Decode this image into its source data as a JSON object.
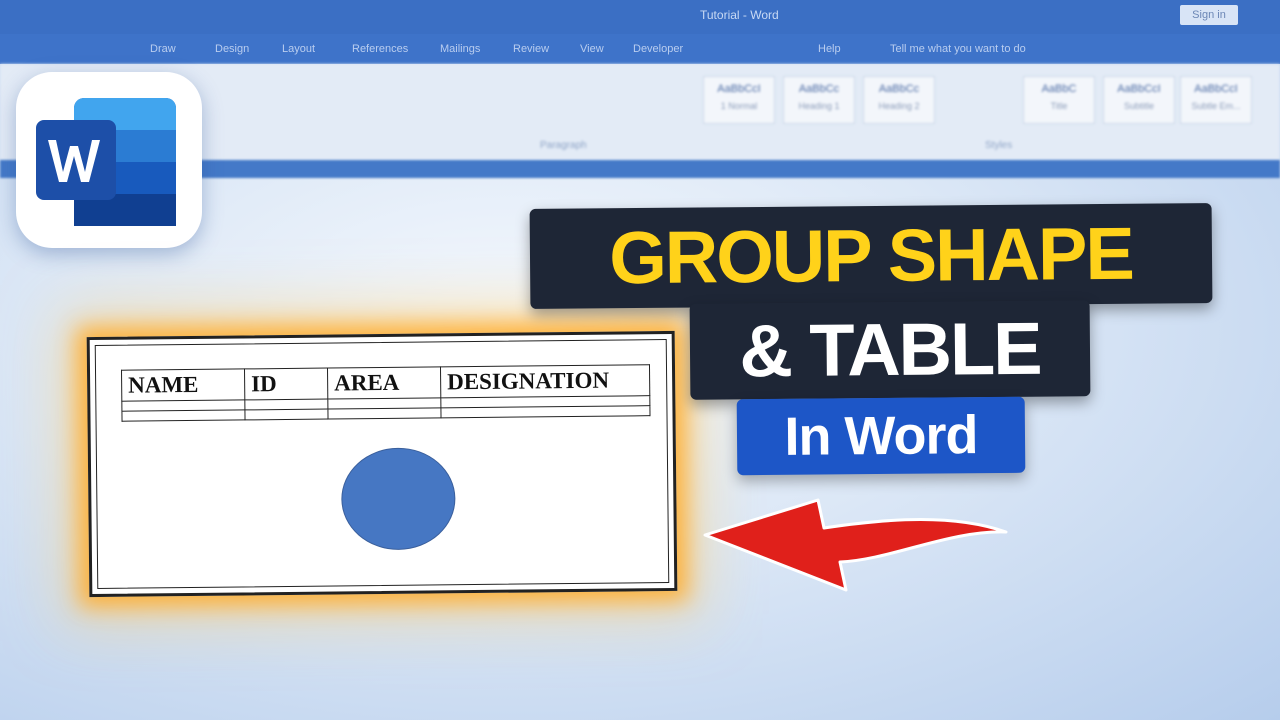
{
  "window": {
    "title": "Tutorial - Word",
    "sign_in": "Sign in"
  },
  "menu": [
    "Draw",
    "Design",
    "Layout",
    "References",
    "Mailings",
    "Review",
    "View",
    "Developer",
    "Help",
    "Tell me what you want to do"
  ],
  "ribbon": {
    "groups": [
      "Paragraph",
      "Styles"
    ],
    "styles": [
      {
        "sample": "AaBbCcI",
        "name": "1 Normal"
      },
      {
        "sample": "AaBbCc",
        "name": "Heading 1"
      },
      {
        "sample": "AaBbCc",
        "name": "Heading 2"
      },
      {
        "sample": "AaBbC",
        "name": "Title"
      },
      {
        "sample": "AaBbCcI",
        "name": "Subtitle"
      },
      {
        "sample": "AaBbCcI",
        "name": "Subtle Em..."
      }
    ]
  },
  "thumbnail": {
    "logo": "Microsoft Word",
    "headline_1": "GROUP SHAPE",
    "headline_2": "& TABLE",
    "badge": "In Word",
    "table_headers": [
      "NAME",
      "ID",
      "AREA",
      "DESIGNATION"
    ],
    "colors": {
      "headline_yellow": "#ffd21a",
      "headline_bg": "#1e2636",
      "badge_blue": "#1d56c7",
      "circle_blue": "#4677c3",
      "arrow_red": "#e0201b",
      "glow_orange": "#ffaa28"
    },
    "icons": [
      "word-logo-icon",
      "red-curved-arrow-icon"
    ]
  }
}
